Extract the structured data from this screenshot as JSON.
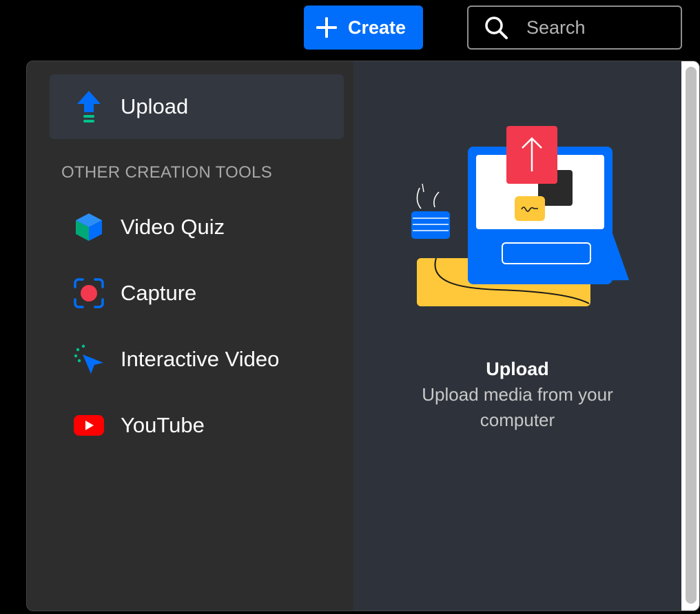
{
  "topbar": {
    "create_label": "Create",
    "search_placeholder": "Search"
  },
  "menu": {
    "primary_item": {
      "label": "Upload",
      "icon": "upload-arrow-icon"
    },
    "section_title": "OTHER CREATION TOOLS",
    "tools": [
      {
        "label": "Video Quiz",
        "icon": "cube-icon"
      },
      {
        "label": "Capture",
        "icon": "record-icon"
      },
      {
        "label": "Interactive Video",
        "icon": "cursor-click-icon"
      },
      {
        "label": "YouTube",
        "icon": "youtube-icon"
      }
    ]
  },
  "preview": {
    "title": "Upload",
    "description": "Upload media from your computer"
  },
  "colors": {
    "accent": "#006efa",
    "panel_left": "#2d2d2e",
    "panel_right": "#2e333b",
    "selected_item": "#333740"
  }
}
